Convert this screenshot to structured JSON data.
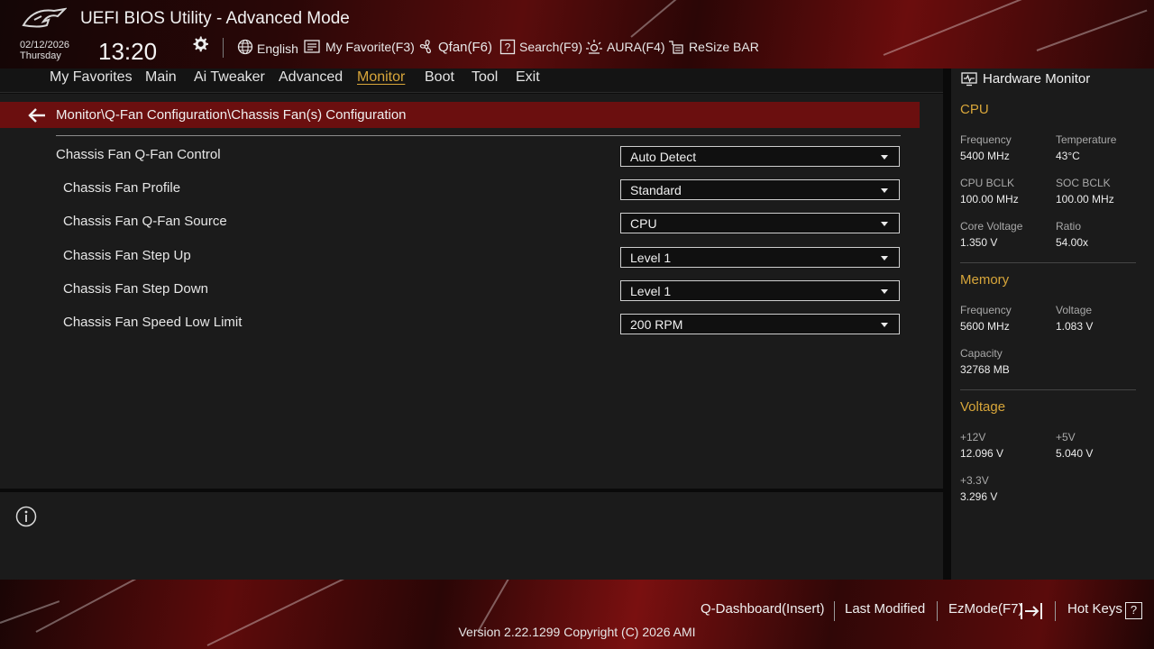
{
  "header": {
    "title": "UEFI BIOS Utility - Advanced Mode",
    "date": "02/12/2026",
    "day": "Thursday",
    "time": "13:20",
    "toolbar": {
      "language": "English",
      "favorite": "My Favorite(F3)",
      "qfan": "Qfan(F6)",
      "search": "Search(F9)",
      "aura": "AURA(F4)",
      "resize_bar": "ReSize BAR"
    }
  },
  "menu": [
    "My Favorites",
    "Main",
    "Ai Tweaker",
    "Advanced",
    "Monitor",
    "Boot",
    "Tool",
    "Exit"
  ],
  "active_menu": "Monitor",
  "breadcrumb": "Monitor\\Q-Fan Configuration\\Chassis Fan(s) Configuration",
  "settings": [
    {
      "label": "Chassis Fan Q-Fan Control",
      "value": "Auto Detect"
    },
    {
      "label": "Chassis Fan Profile",
      "value": "Standard"
    },
    {
      "label": "Chassis Fan Q-Fan Source",
      "value": "CPU"
    },
    {
      "label": "Chassis Fan Step Up",
      "value": "Level 1"
    },
    {
      "label": "Chassis Fan Step Down",
      "value": "Level 1"
    },
    {
      "label": "Chassis Fan Speed Low Limit",
      "value": "200 RPM"
    }
  ],
  "hardware_monitor": {
    "title": "Hardware Monitor",
    "cpu": {
      "title": "CPU",
      "frequency_label": "Frequency",
      "frequency": "5400 MHz",
      "temperature_label": "Temperature",
      "temperature": "43°C",
      "cpu_bclk_label": "CPU BCLK",
      "cpu_bclk": "100.00 MHz",
      "soc_bclk_label": "SOC BCLK",
      "soc_bclk": "100.00 MHz",
      "core_voltage_label": "Core Voltage",
      "core_voltage": "1.350 V",
      "ratio_label": "Ratio",
      "ratio": "54.00x"
    },
    "memory": {
      "title": "Memory",
      "frequency_label": "Frequency",
      "frequency": "5600 MHz",
      "voltage_label": "Voltage",
      "voltage": "1.083 V",
      "capacity_label": "Capacity",
      "capacity": "32768 MB"
    },
    "voltage": {
      "title": "Voltage",
      "v12_label": "+12V",
      "v12": "12.096 V",
      "v5_label": "+5V",
      "v5": "5.040 V",
      "v33_label": "+3.3V",
      "v33": "3.296 V"
    }
  },
  "footer": {
    "q_dashboard": "Q-Dashboard(Insert)",
    "last_modified": "Last Modified",
    "ezmode": "EzMode(F7)",
    "hot_keys": "Hot Keys",
    "hot_keys_symbol": "?",
    "version": "Version 2.22.1299 Copyright (C) 2026 AMI"
  },
  "colors": {
    "accent": "#d8a63a",
    "breadcrumb_bar": "#6b0f0f",
    "panel": "#1b1b1b"
  }
}
